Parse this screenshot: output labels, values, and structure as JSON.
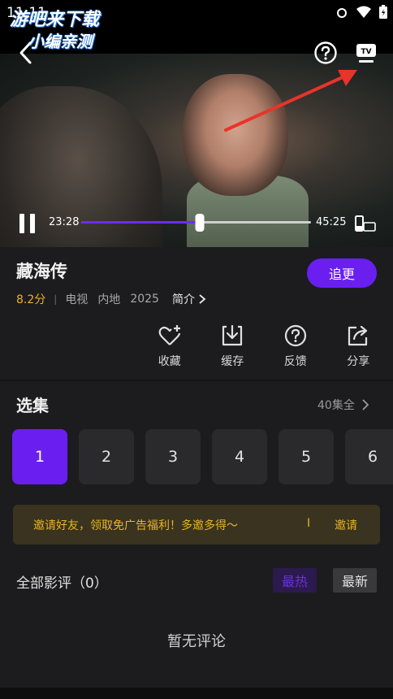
{
  "status": {
    "time": "11:11"
  },
  "watermark": {
    "line1": "游吧来下载",
    "line2": "小编亲测"
  },
  "player": {
    "current_time": "23:28",
    "total_time": "45:25",
    "progress": 0.516,
    "colors": {
      "progress_fill": "#6b2df0",
      "annotation_arrow": "#e8342a"
    }
  },
  "show": {
    "title": "藏海传",
    "follow_label": "追更",
    "score": "8.2分",
    "separator": "|",
    "type": "电视",
    "region": "内地",
    "year": "2025",
    "intro_label": "简介"
  },
  "actions": [
    {
      "label": "收藏",
      "icon": "heart-plus-icon"
    },
    {
      "label": "缓存",
      "icon": "download-icon"
    },
    {
      "label": "反馈",
      "icon": "help-icon"
    },
    {
      "label": "分享",
      "icon": "share-icon"
    }
  ],
  "episodes": {
    "section_title": "选集",
    "total_label": "40集全",
    "items": [
      "1",
      "2",
      "3",
      "4",
      "5",
      "6"
    ],
    "active_index": 0
  },
  "banner": {
    "text": "邀请好友，领取免广告福利！多邀多得～",
    "separator": "I",
    "action_label": "邀请"
  },
  "reviews": {
    "title": "全部影评（0）",
    "sort_hot": "最热",
    "sort_new": "最新",
    "empty_text": "暂无评论"
  },
  "colors": {
    "accent": "#6a1ff0",
    "score": "#e8b22a",
    "banner_text": "#e6b422",
    "background": "#1c1c1e"
  }
}
